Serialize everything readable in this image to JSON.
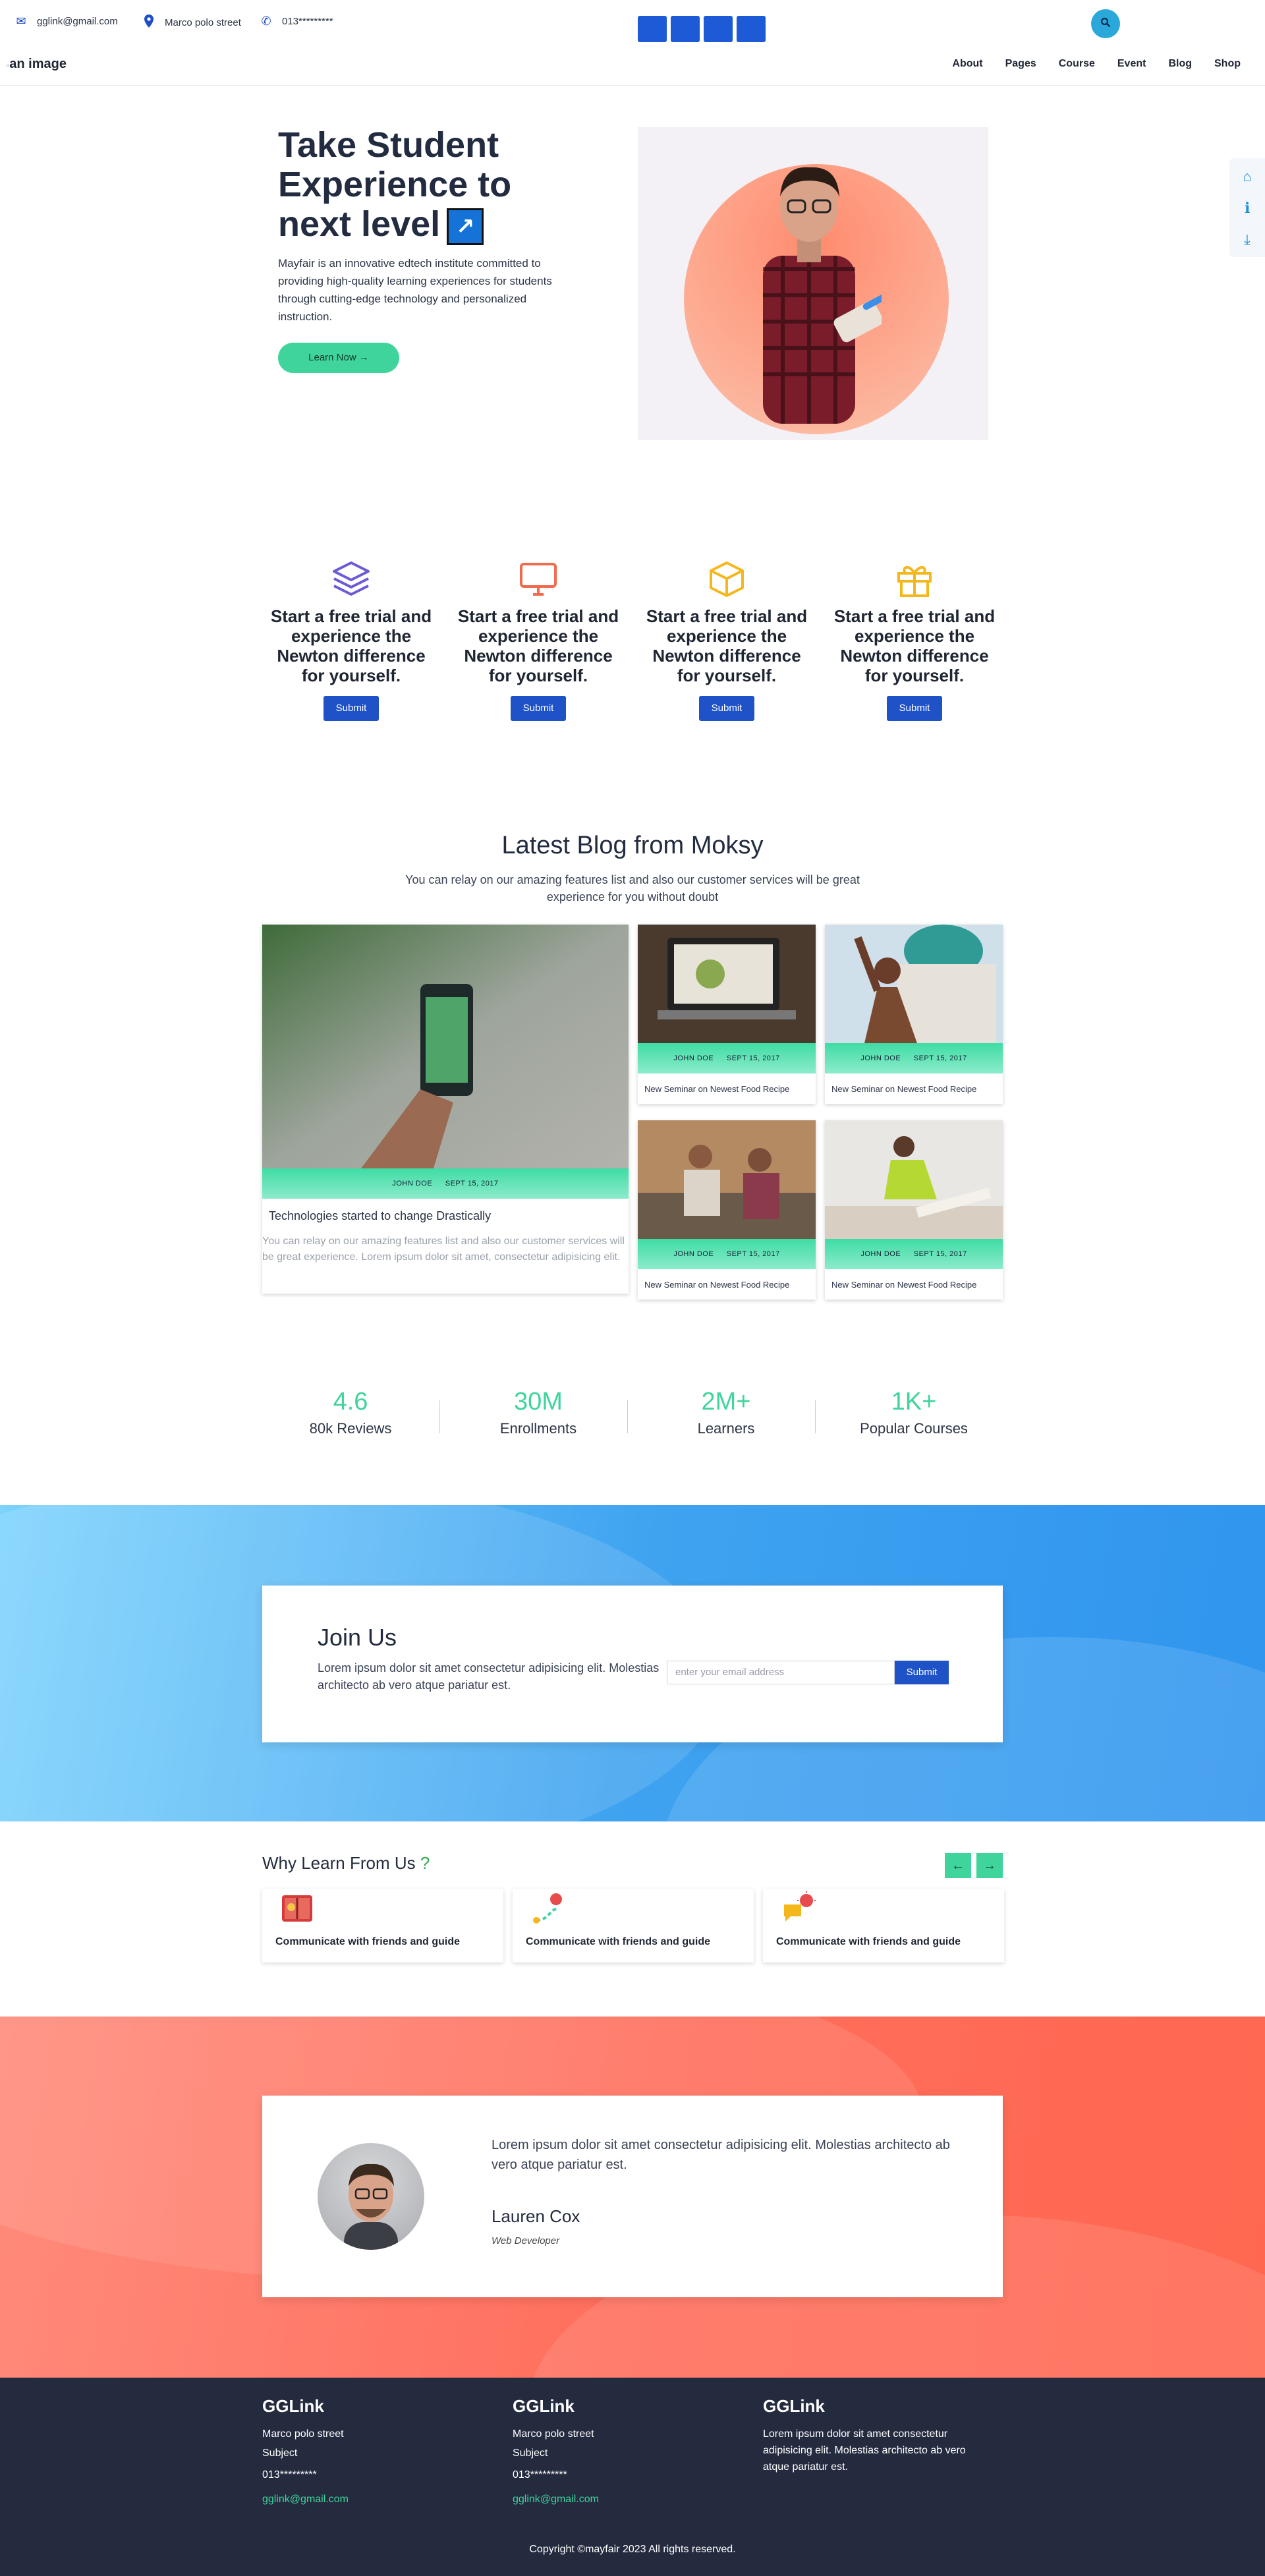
{
  "topbar": {
    "email": "gglink@gmail.com",
    "address": "Marco polo street",
    "phone": "013*********",
    "email_icon": "envelope-icon",
    "address_icon": "map-pin-icon",
    "phone_icon": "phone-icon"
  },
  "nav": {
    "logo_alt": "an image",
    "items": [
      "About",
      "Pages",
      "Course",
      "Event",
      "Blog",
      "Shop"
    ]
  },
  "dock": {
    "icons": [
      "home-icon",
      "info-icon",
      "download-icon"
    ]
  },
  "hero": {
    "title": "Take Student Experience to next level",
    "description": "Mayfair is an innovative edtech institute committed to providing high-quality learning experiences for students through cutting-edge technology and personalized instruction.",
    "button": "Learn Now →"
  },
  "features": [
    {
      "icon": "layers-icon",
      "color": "#6a5bd6",
      "title": "Start a free trial and experience the Newton difference for yourself.",
      "button": "Submit"
    },
    {
      "icon": "monitor-icon",
      "color": "#f06a4e",
      "title": "Start a free trial and experience the Newton difference for yourself.",
      "button": "Submit"
    },
    {
      "icon": "box-icon",
      "color": "#f4b81c",
      "title": "Start a free trial and experience the Newton difference for yourself.",
      "button": "Submit"
    },
    {
      "icon": "gift-icon",
      "color": "#f4b81c",
      "title": "Start a free trial and experience the Newton difference for yourself.",
      "button": "Submit"
    }
  ],
  "blog": {
    "title": "Latest Blog from Moksy",
    "subtitle": "You can relay on our amazing features list and also our customer services will be great experience for you without doubt",
    "featured": {
      "author": "JOHN DOE",
      "date": "SEPT 15, 2017",
      "title": "Technologies started to change Drastically",
      "excerpt": "You can relay on our amazing features list and also our customer services will be great experience. Lorem ipsum dolor sit amet, consectetur adipisicing elit."
    },
    "posts": [
      {
        "author": "JOHN DOE",
        "date": "SEPT 15, 2017",
        "title": "New Seminar on Newest Food Recipe"
      },
      {
        "author": "JOHN DOE",
        "date": "SEPT 15, 2017",
        "title": "New Seminar on Newest Food Recipe"
      },
      {
        "author": "JOHN DOE",
        "date": "SEPT 15, 2017",
        "title": "New Seminar on Newest Food Recipe"
      },
      {
        "author": "JOHN DOE",
        "date": "SEPT 15, 2017",
        "title": "New Seminar on Newest Food Recipe"
      }
    ]
  },
  "stats": [
    {
      "value": "4.6",
      "label": "80k Reviews"
    },
    {
      "value": "30M",
      "label": "Enrollments"
    },
    {
      "value": "2M+",
      "label": "Learners"
    },
    {
      "value": "1K+",
      "label": "Popular Courses"
    }
  ],
  "join": {
    "title": "Join Us",
    "text": "Lorem ipsum dolor sit amet consectetur adipisicing elit. Molestias architecto ab vero atque pariatur est.",
    "placeholder": "enter your email address",
    "button": "Submit"
  },
  "why": {
    "title": "Why Learn From Us",
    "question_mark": "?",
    "prev": "←",
    "next": "→",
    "cards": [
      {
        "icon": "book-icon",
        "title": "Communicate with friends and guide"
      },
      {
        "icon": "route-icon",
        "title": "Communicate with friends and guide"
      },
      {
        "icon": "chat-idea-icon",
        "title": "Communicate with friends and guide"
      }
    ]
  },
  "testimonial": {
    "quote": "Lorem ipsum dolor sit amet consectetur adipisicing elit. Molestias architecto ab vero atque pariatur est.",
    "name": "Lauren Cox",
    "role": "Web Developer"
  },
  "footer": {
    "columns": [
      {
        "title": "GGLink",
        "line1": "Marco polo street",
        "line2": "Subject",
        "phone": "013*********",
        "email": "gglink@gmail.com"
      },
      {
        "title": "GGLink",
        "line1": "Marco polo street",
        "line2": "Subject",
        "phone": "013*********",
        "email": "gglink@gmail.com"
      },
      {
        "title": "GGLink",
        "text": "Lorem ipsum dolor sit amet consectetur adipisicing elit. Molestias architecto ab vero atque pariatur est."
      }
    ],
    "copyright": "Copyright ©mayfair 2023 All rights reserved."
  }
}
